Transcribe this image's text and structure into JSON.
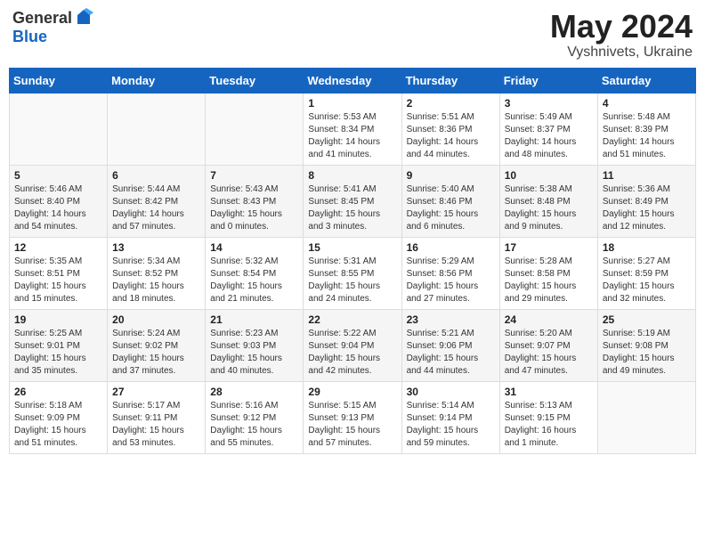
{
  "header": {
    "logo_line1": "General",
    "logo_line2": "Blue",
    "month_title": "May 2024",
    "location": "Vyshnivets, Ukraine"
  },
  "weekdays": [
    "Sunday",
    "Monday",
    "Tuesday",
    "Wednesday",
    "Thursday",
    "Friday",
    "Saturday"
  ],
  "weeks": [
    [
      {
        "day": "",
        "info": ""
      },
      {
        "day": "",
        "info": ""
      },
      {
        "day": "",
        "info": ""
      },
      {
        "day": "1",
        "info": "Sunrise: 5:53 AM\nSunset: 8:34 PM\nDaylight: 14 hours\nand 41 minutes."
      },
      {
        "day": "2",
        "info": "Sunrise: 5:51 AM\nSunset: 8:36 PM\nDaylight: 14 hours\nand 44 minutes."
      },
      {
        "day": "3",
        "info": "Sunrise: 5:49 AM\nSunset: 8:37 PM\nDaylight: 14 hours\nand 48 minutes."
      },
      {
        "day": "4",
        "info": "Sunrise: 5:48 AM\nSunset: 8:39 PM\nDaylight: 14 hours\nand 51 minutes."
      }
    ],
    [
      {
        "day": "5",
        "info": "Sunrise: 5:46 AM\nSunset: 8:40 PM\nDaylight: 14 hours\nand 54 minutes."
      },
      {
        "day": "6",
        "info": "Sunrise: 5:44 AM\nSunset: 8:42 PM\nDaylight: 14 hours\nand 57 minutes."
      },
      {
        "day": "7",
        "info": "Sunrise: 5:43 AM\nSunset: 8:43 PM\nDaylight: 15 hours\nand 0 minutes."
      },
      {
        "day": "8",
        "info": "Sunrise: 5:41 AM\nSunset: 8:45 PM\nDaylight: 15 hours\nand 3 minutes."
      },
      {
        "day": "9",
        "info": "Sunrise: 5:40 AM\nSunset: 8:46 PM\nDaylight: 15 hours\nand 6 minutes."
      },
      {
        "day": "10",
        "info": "Sunrise: 5:38 AM\nSunset: 8:48 PM\nDaylight: 15 hours\nand 9 minutes."
      },
      {
        "day": "11",
        "info": "Sunrise: 5:36 AM\nSunset: 8:49 PM\nDaylight: 15 hours\nand 12 minutes."
      }
    ],
    [
      {
        "day": "12",
        "info": "Sunrise: 5:35 AM\nSunset: 8:51 PM\nDaylight: 15 hours\nand 15 minutes."
      },
      {
        "day": "13",
        "info": "Sunrise: 5:34 AM\nSunset: 8:52 PM\nDaylight: 15 hours\nand 18 minutes."
      },
      {
        "day": "14",
        "info": "Sunrise: 5:32 AM\nSunset: 8:54 PM\nDaylight: 15 hours\nand 21 minutes."
      },
      {
        "day": "15",
        "info": "Sunrise: 5:31 AM\nSunset: 8:55 PM\nDaylight: 15 hours\nand 24 minutes."
      },
      {
        "day": "16",
        "info": "Sunrise: 5:29 AM\nSunset: 8:56 PM\nDaylight: 15 hours\nand 27 minutes."
      },
      {
        "day": "17",
        "info": "Sunrise: 5:28 AM\nSunset: 8:58 PM\nDaylight: 15 hours\nand 29 minutes."
      },
      {
        "day": "18",
        "info": "Sunrise: 5:27 AM\nSunset: 8:59 PM\nDaylight: 15 hours\nand 32 minutes."
      }
    ],
    [
      {
        "day": "19",
        "info": "Sunrise: 5:25 AM\nSunset: 9:01 PM\nDaylight: 15 hours\nand 35 minutes."
      },
      {
        "day": "20",
        "info": "Sunrise: 5:24 AM\nSunset: 9:02 PM\nDaylight: 15 hours\nand 37 minutes."
      },
      {
        "day": "21",
        "info": "Sunrise: 5:23 AM\nSunset: 9:03 PM\nDaylight: 15 hours\nand 40 minutes."
      },
      {
        "day": "22",
        "info": "Sunrise: 5:22 AM\nSunset: 9:04 PM\nDaylight: 15 hours\nand 42 minutes."
      },
      {
        "day": "23",
        "info": "Sunrise: 5:21 AM\nSunset: 9:06 PM\nDaylight: 15 hours\nand 44 minutes."
      },
      {
        "day": "24",
        "info": "Sunrise: 5:20 AM\nSunset: 9:07 PM\nDaylight: 15 hours\nand 47 minutes."
      },
      {
        "day": "25",
        "info": "Sunrise: 5:19 AM\nSunset: 9:08 PM\nDaylight: 15 hours\nand 49 minutes."
      }
    ],
    [
      {
        "day": "26",
        "info": "Sunrise: 5:18 AM\nSunset: 9:09 PM\nDaylight: 15 hours\nand 51 minutes."
      },
      {
        "day": "27",
        "info": "Sunrise: 5:17 AM\nSunset: 9:11 PM\nDaylight: 15 hours\nand 53 minutes."
      },
      {
        "day": "28",
        "info": "Sunrise: 5:16 AM\nSunset: 9:12 PM\nDaylight: 15 hours\nand 55 minutes."
      },
      {
        "day": "29",
        "info": "Sunrise: 5:15 AM\nSunset: 9:13 PM\nDaylight: 15 hours\nand 57 minutes."
      },
      {
        "day": "30",
        "info": "Sunrise: 5:14 AM\nSunset: 9:14 PM\nDaylight: 15 hours\nand 59 minutes."
      },
      {
        "day": "31",
        "info": "Sunrise: 5:13 AM\nSunset: 9:15 PM\nDaylight: 16 hours\nand 1 minute."
      },
      {
        "day": "",
        "info": ""
      }
    ]
  ]
}
